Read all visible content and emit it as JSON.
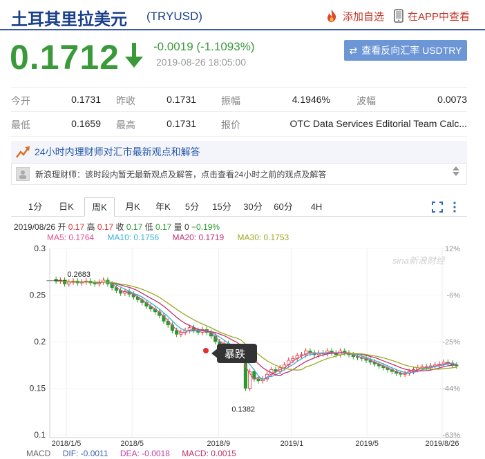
{
  "header": {
    "title": "土耳其里拉美元",
    "code": "(TRYUSD)",
    "fav_label": "添加自选",
    "app_label": "在APP中查看"
  },
  "quote": {
    "price": "0.1712",
    "change": "-0.0019 (-1.1093%)",
    "time": "2019-08-26 18:05:00",
    "reverse_button": "查看反向汇率 USDTRY",
    "color_down": "#3a9a3a"
  },
  "stats": {
    "open_label": "今开",
    "open": "0.1731",
    "prev_label": "昨收",
    "prev": "0.1731",
    "amp_label": "振幅",
    "amp": "4.1946%",
    "wave_label": "波幅",
    "wave": "0.0073",
    "low_label": "最低",
    "low": "0.1659",
    "high_label": "最高",
    "high": "0.1731",
    "quote_label": "报价",
    "quote_source": "OTC Data Services Editorial Team Calc..."
  },
  "advice": {
    "title": "24小时内理财师对汇市最新观点和解答",
    "notice": "新浪理财师：该时段内暂无最新观点及解答，点击查看24小时之前的观点及解答"
  },
  "tabs": [
    "1分",
    "日K",
    "周K",
    "月K",
    "年K",
    "5分",
    "15分",
    "30分",
    "60分",
    "4H"
  ],
  "active_tab": "周K",
  "info": {
    "date": "2019/08/26",
    "open_label": "开",
    "open": "0.17",
    "high_label": "高",
    "high": "0.17",
    "close_label": "收",
    "close": "0.17",
    "low_label": "低",
    "low": "0.17",
    "vol_label": "量",
    "vol": "0",
    "pct": "−0.19%",
    "ma5": "MA5: 0.1764",
    "ma10": "MA10: 0.1756",
    "ma20": "MA20: 0.1719",
    "ma30": "MA30: 0.1753"
  },
  "macd": {
    "label": "MACD",
    "dif": "DIF: -0.0011",
    "dea": "DEA: -0.0018",
    "macd": "MACD: 0.0015"
  },
  "chart_data": {
    "type": "candlestick",
    "watermark": "sina新浪财经",
    "y_ticks": [
      "0.3",
      "0.25",
      "0.2",
      "0.15",
      "0.1"
    ],
    "y_values": [
      0.3,
      0.25,
      0.2,
      0.15,
      0.1
    ],
    "right_ticks": [
      "12%",
      "-6%",
      "-25%",
      "-44%",
      "-63%"
    ],
    "x_ticks": [
      "2018/1/5",
      "2018/5",
      "2018/9",
      "2019/1",
      "2019/5",
      "2019/8/26"
    ],
    "ylim": [
      0.1,
      0.3
    ],
    "annotations": {
      "peak": "0.2683",
      "trough": "0.1382",
      "callout": "暴跌"
    },
    "series_colors": {
      "up": "#e03030",
      "down": "#2a9a2a",
      "ma5": "#e0508a",
      "ma10": "#3ab0d8",
      "ma20": "#c03070",
      "ma30": "#9aaa20"
    },
    "close_series": [
      0.265,
      0.266,
      0.262,
      0.264,
      0.265,
      0.263,
      0.264,
      0.265,
      0.263,
      0.262,
      0.264,
      0.266,
      0.262,
      0.258,
      0.255,
      0.252,
      0.254,
      0.251,
      0.248,
      0.245,
      0.242,
      0.238,
      0.235,
      0.232,
      0.228,
      0.222,
      0.218,
      0.212,
      0.208,
      0.21,
      0.212,
      0.215,
      0.212,
      0.21,
      0.213,
      0.21,
      0.206,
      0.2,
      0.195,
      0.198,
      0.192,
      0.19,
      0.19,
      0.18,
      0.15,
      0.168,
      0.16,
      0.158,
      0.16,
      0.165,
      0.17,
      0.168,
      0.172,
      0.175,
      0.18,
      0.182,
      0.185,
      0.186,
      0.19,
      0.188,
      0.186,
      0.188,
      0.187,
      0.19,
      0.188,
      0.186,
      0.19,
      0.188,
      0.186,
      0.184,
      0.183,
      0.182,
      0.18,
      0.178,
      0.176,
      0.174,
      0.172,
      0.17,
      0.168,
      0.166,
      0.165,
      0.166,
      0.168,
      0.17,
      0.172,
      0.173,
      0.172,
      0.174,
      0.175,
      0.176,
      0.178,
      0.177,
      0.175,
      0.174
    ]
  }
}
